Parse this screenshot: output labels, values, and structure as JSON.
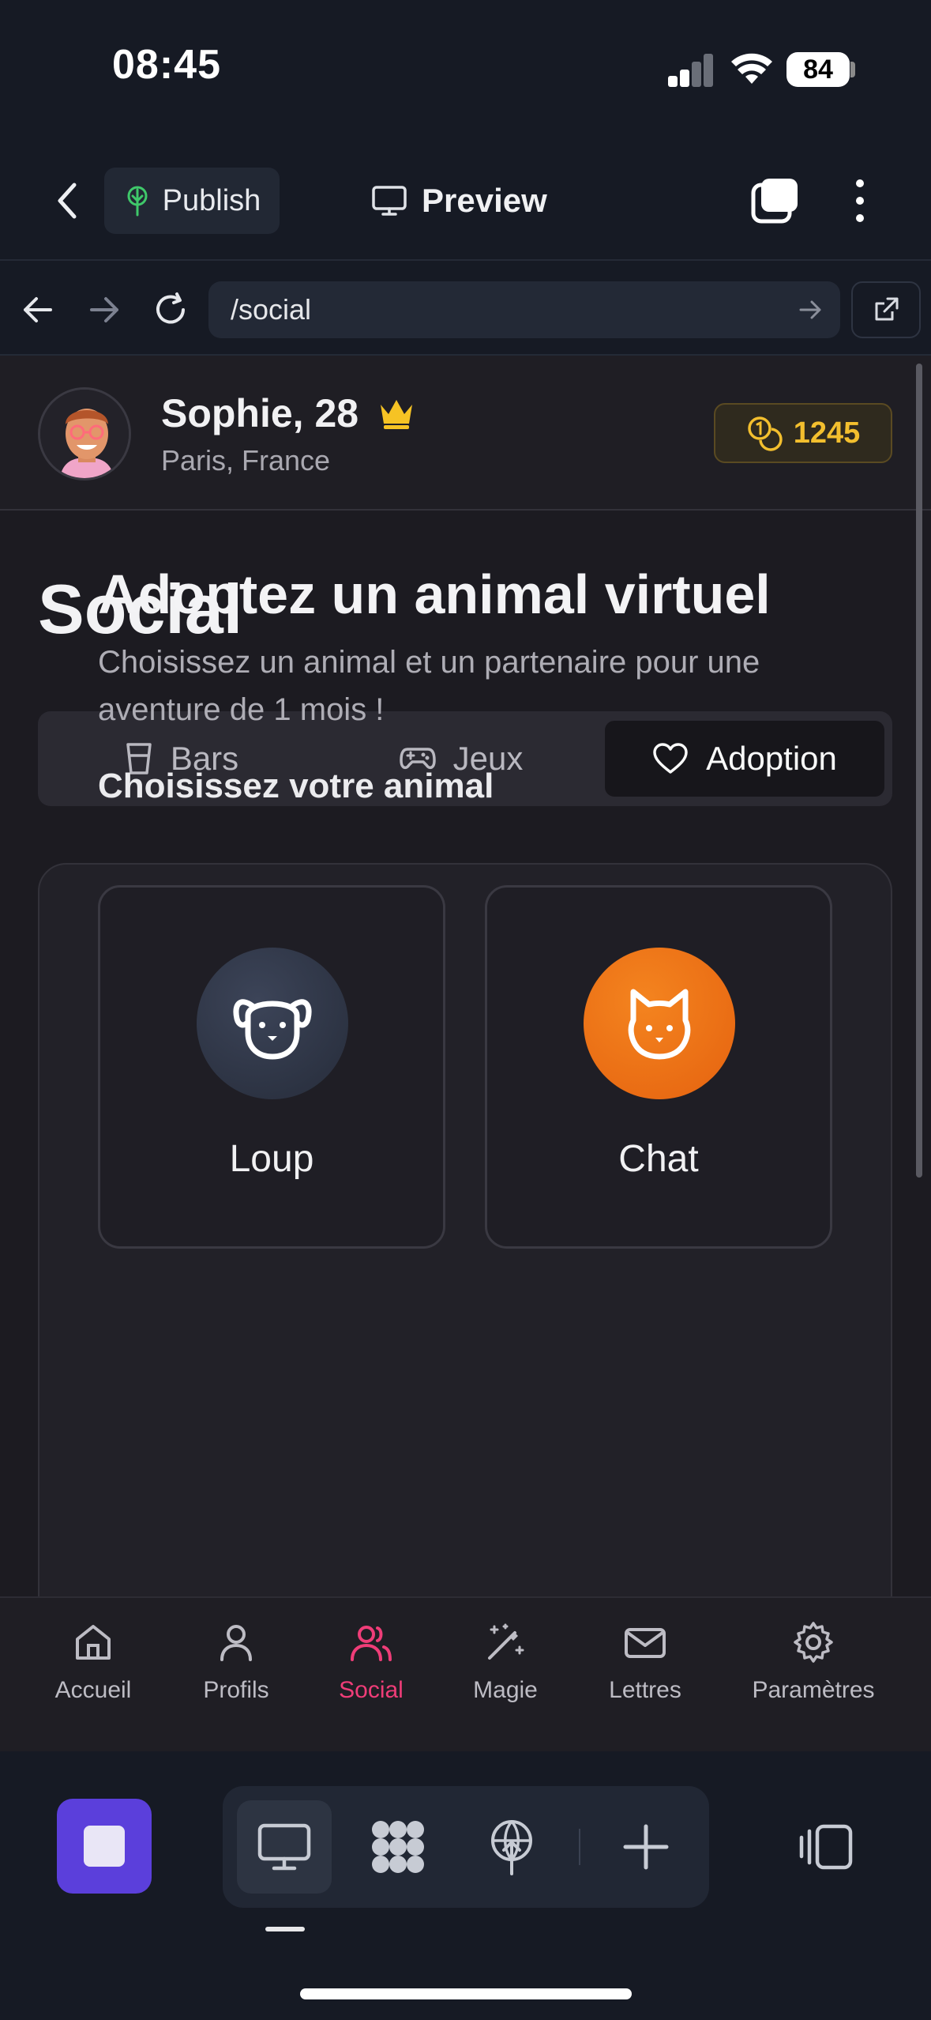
{
  "status_bar": {
    "time": "08:45",
    "battery": "84"
  },
  "header": {
    "publish_label": "Publish",
    "preview_label": "Preview"
  },
  "browser": {
    "url": "/social"
  },
  "profile": {
    "name": "Sophie, 28",
    "location": "Paris, France",
    "coins": "1245"
  },
  "page_title": "Social",
  "tabs": [
    {
      "label": "Bars",
      "icon": "glass-icon"
    },
    {
      "label": "Jeux",
      "icon": "gamepad-icon"
    },
    {
      "label": "Adoption",
      "icon": "heart-icon",
      "active": true
    }
  ],
  "adoption": {
    "title": "Adoptez un animal virtuel",
    "description": "Choisissez un animal et un partenaire pour une aventure de 1 mois !",
    "choose_label": "Choisissez votre animal",
    "animals": [
      {
        "label": "Loup",
        "icon": "dog-icon",
        "color": "#2d3446"
      },
      {
        "label": "Chat",
        "icon": "cat-icon",
        "color": "#f0731a"
      }
    ]
  },
  "bottom_nav": [
    {
      "label": "Accueil",
      "icon": "home-icon"
    },
    {
      "label": "Profils",
      "icon": "user-icon"
    },
    {
      "label": "Social",
      "icon": "users-icon",
      "active": true
    },
    {
      "label": "Magie",
      "icon": "magic-wand-icon"
    },
    {
      "label": "Lettres",
      "icon": "mail-icon"
    },
    {
      "label": "Paramètres",
      "icon": "settings-icon"
    }
  ],
  "colors": {
    "accent_pink": "#ef3d78",
    "coin_gold": "#f3bf2e",
    "stop_purple": "#5b3fdb",
    "crown_gold": "#f6c324"
  }
}
